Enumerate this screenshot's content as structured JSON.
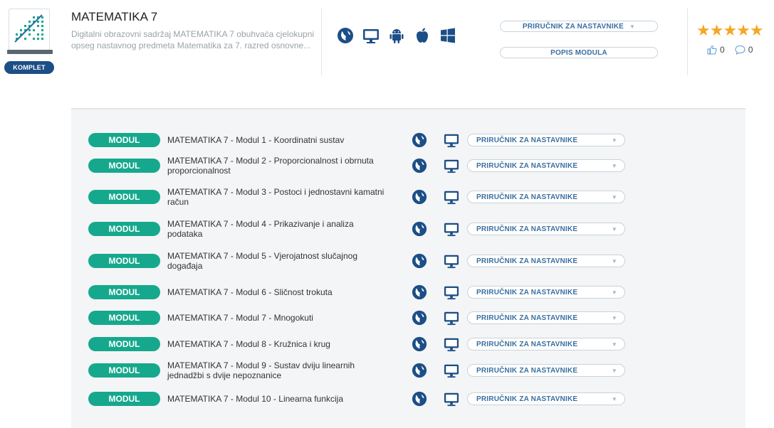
{
  "header": {
    "title": "MATEMATIKA 7",
    "description": "Digitalni obrazovni sadržaj MATEMATIKA 7 obuhvaća cjelokupni opseg nastavnog predmeta Matematika za 7. razred osnovne...",
    "badge": "KOMPLET",
    "platform_icons": [
      "globe-icon",
      "monitor-icon",
      "android-icon",
      "apple-icon",
      "windows-icon"
    ],
    "manual_button": "PRIRUČNIK ZA NASTAVNIKE",
    "modules_button": "POPIS MODULA",
    "rating_stars": "★★★★★",
    "likes": "0",
    "comments": "0"
  },
  "colors": {
    "modul_badge": "#16a88d",
    "komplet_badge": "#1c4e87",
    "icon_blue": "#1c4e87",
    "star": "#f5a623",
    "link_blue": "#3a6fa0"
  },
  "modules": [
    {
      "badge": "MODUL",
      "title": "MATEMATIKA 7 - Modul 1 - Koordinatni sustav",
      "manual": "PRIRUČNIK ZA NASTAVNIKE"
    },
    {
      "badge": "MODUL",
      "title": "MATEMATIKA 7 - Modul 2 - Proporcionalnost i obrnuta proporcionalnost",
      "manual": "PRIRUČNIK ZA NASTAVNIKE"
    },
    {
      "badge": "MODUL",
      "title": "MATEMATIKA 7 - Modul 3 - Postoci i jednostavni kamatni račun",
      "manual": "PRIRUČNIK ZA NASTAVNIKE"
    },
    {
      "badge": "MODUL",
      "title": "MATEMATIKA 7 - Modul 4 - Prikazivanje i analiza podataka",
      "manual": "PRIRUČNIK ZA NASTAVNIKE"
    },
    {
      "badge": "MODUL",
      "title": "MATEMATIKA 7 - Modul 5 - Vjerojatnost slučajnog događaja",
      "manual": "PRIRUČNIK ZA NASTAVNIKE"
    },
    {
      "badge": "MODUL",
      "title": "MATEMATIKA 7 - Modul 6 - Sličnost trokuta",
      "manual": "PRIRUČNIK ZA NASTAVNIKE"
    },
    {
      "badge": "MODUL",
      "title": "MATEMATIKA 7 - Modul 7 - Mnogokuti",
      "manual": "PRIRUČNIK ZA NASTAVNIKE"
    },
    {
      "badge": "MODUL",
      "title": "MATEMATIKA 7 - Modul 8 - Kružnica i krug",
      "manual": "PRIRUČNIK ZA NASTAVNIKE"
    },
    {
      "badge": "MODUL",
      "title": "MATEMATIKA 7 - Modul 9 - Sustav dviju linearnih jednadžbi s dvije nepoznanice",
      "manual": "PRIRUČNIK ZA NASTAVNIKE"
    },
    {
      "badge": "MODUL",
      "title": "MATEMATIKA 7 - Modul 10 - Linearna funkcija",
      "manual": "PRIRUČNIK ZA NASTAVNIKE"
    }
  ]
}
